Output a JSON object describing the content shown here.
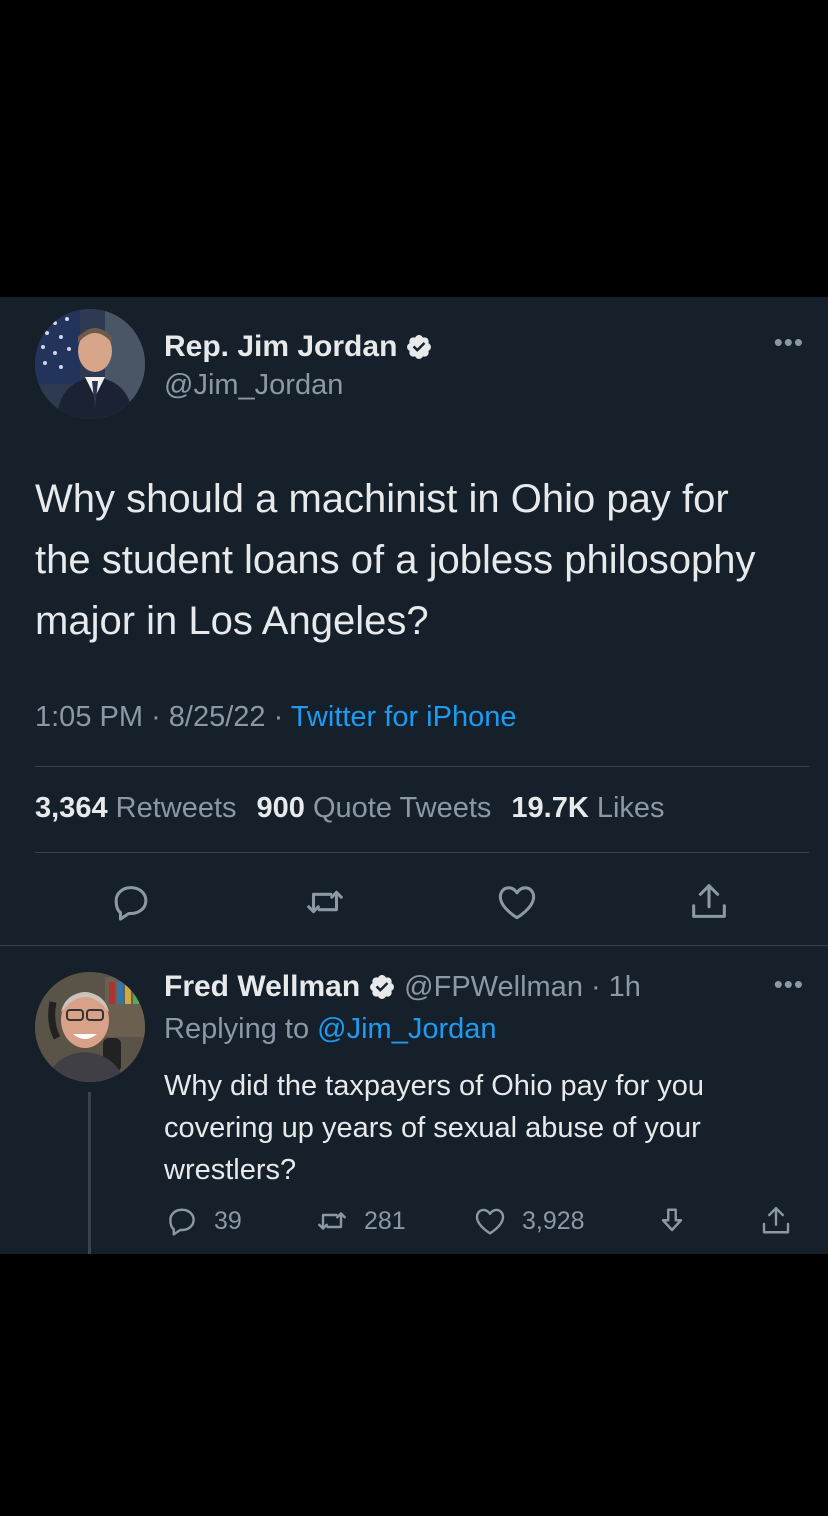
{
  "tweet": {
    "display_name": "Rep. Jim Jordan",
    "handle": "@Jim_Jordan",
    "verified": true,
    "text": "Why should a machinist in Ohio pay for the student loans of a jobless philosophy major in Los Angeles?",
    "time": "1:05 PM",
    "date": "8/25/22",
    "source": "Twitter for iPhone",
    "retweets_count": "3,364",
    "retweets_label": "Retweets",
    "quotes_count": "900",
    "quotes_label": "Quote Tweets",
    "likes_count": "19.7K",
    "likes_label": "Likes",
    "more_label": "•••"
  },
  "reply": {
    "display_name": "Fred Wellman",
    "handle": "@FPWellman",
    "time_ago": "1h",
    "verified": true,
    "replying_prefix": "Replying to",
    "replying_to": "@Jim_Jordan",
    "text": "Why did the taxpayers of Ohio pay for you covering up years of sexual abuse of your wrestlers?",
    "reply_count": "39",
    "retweet_count": "281",
    "like_count": "3,928",
    "more_label": "•••"
  },
  "colors": {
    "background": "#15202b",
    "accent": "#1d9bf0",
    "muted": "#8b98a5",
    "text": "#e7e9ea",
    "border": "#38444d"
  },
  "icons": [
    "verified-badge-icon",
    "more-icon",
    "reply-icon",
    "retweet-icon",
    "like-icon",
    "share-icon",
    "bookmark-icon"
  ]
}
